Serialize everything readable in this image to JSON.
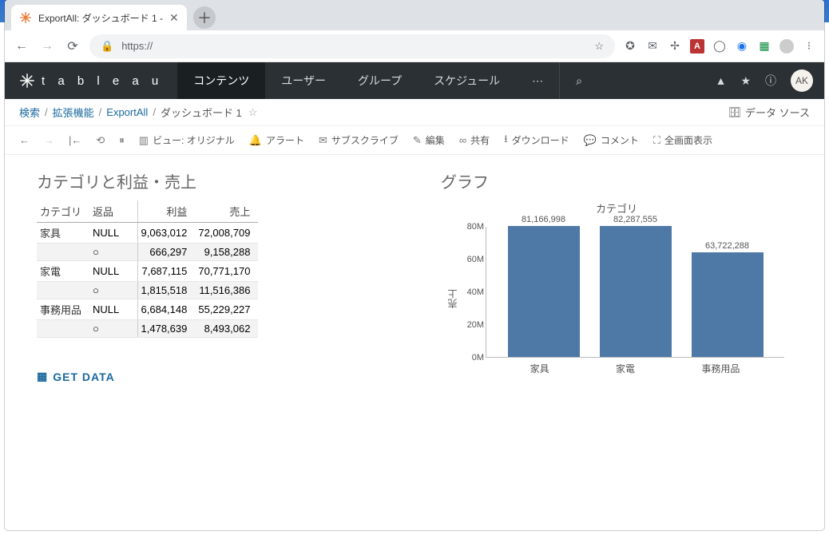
{
  "win": {
    "min": "—",
    "max": "▢",
    "close": "✕"
  },
  "tab": {
    "title": "ExportAll: ダッシュボード 1 -",
    "close": "✕",
    "new": "＋"
  },
  "addr": {
    "url": "https://",
    "star": "☆",
    "icons": [
      "back",
      "forward",
      "reload",
      "lock"
    ],
    "exts": [
      "✪",
      "✉",
      "✢",
      "A",
      "◯",
      "◉",
      "▦",
      "◐",
      "⁝"
    ]
  },
  "tableau": {
    "brand": "t a b l e a u",
    "nav": [
      "コンテンツ",
      "ユーザー",
      "グループ",
      "スケジュール",
      "⋯"
    ],
    "search": "⌕",
    "right": {
      "alert": "▲",
      "star": "★",
      "info": "ⓘ",
      "avatar": "AK"
    }
  },
  "breadcrumb": {
    "items": [
      "検索",
      "拡張機能",
      "ExportAll"
    ],
    "current": "ダッシュボード 1",
    "star": "☆",
    "datasource": "データ ソース"
  },
  "toolbar": {
    "back": "←",
    "fwd": "→",
    "first": "|←",
    "view": "ビュー: オリジナル",
    "alert_label": "アラート",
    "subscribe": "サブスクライブ",
    "edit": "編集",
    "share": "共有",
    "download": "ダウンロード",
    "comment": "コメント",
    "fullscreen": "全画面表示"
  },
  "left_title": "カテゴリと利益・売上",
  "right_title": "グラフ",
  "headers": {
    "cat": "カテゴリ",
    "ret": "返品",
    "profit": "利益",
    "sales": "売上"
  },
  "rows": [
    {
      "cat": "家具",
      "ret": "NULL",
      "profit": "9,063,012",
      "sales": "72,008,709"
    },
    {
      "cat": "",
      "ret": "○",
      "profit": "666,297",
      "sales": "9,158,288",
      "shade": true
    },
    {
      "cat": "家電",
      "ret": "NULL",
      "profit": "7,687,115",
      "sales": "70,771,170"
    },
    {
      "cat": "",
      "ret": "○",
      "profit": "1,815,518",
      "sales": "11,516,386",
      "shade": true
    },
    {
      "cat": "事務用品",
      "ret": "NULL",
      "profit": "6,684,148",
      "sales": "55,229,227"
    },
    {
      "cat": "",
      "ret": "○",
      "profit": "1,478,639",
      "sales": "8,493,062",
      "shade": true
    }
  ],
  "chart_data": {
    "type": "bar",
    "title": "カテゴリ",
    "ylabel": "売上",
    "ylim": [
      0,
      80000000
    ],
    "yticks": [
      0,
      20000000,
      40000000,
      60000000,
      80000000
    ],
    "ytick_labels": [
      "0M",
      "20M",
      "40M",
      "60M",
      "80M"
    ],
    "categories": [
      "家具",
      "家電",
      "事務用品"
    ],
    "values": [
      81166998,
      82287555,
      63722288
    ],
    "value_labels": [
      "81,166,998",
      "82,287,555",
      "63,722,288"
    ]
  },
  "getdata": "GET DATA"
}
